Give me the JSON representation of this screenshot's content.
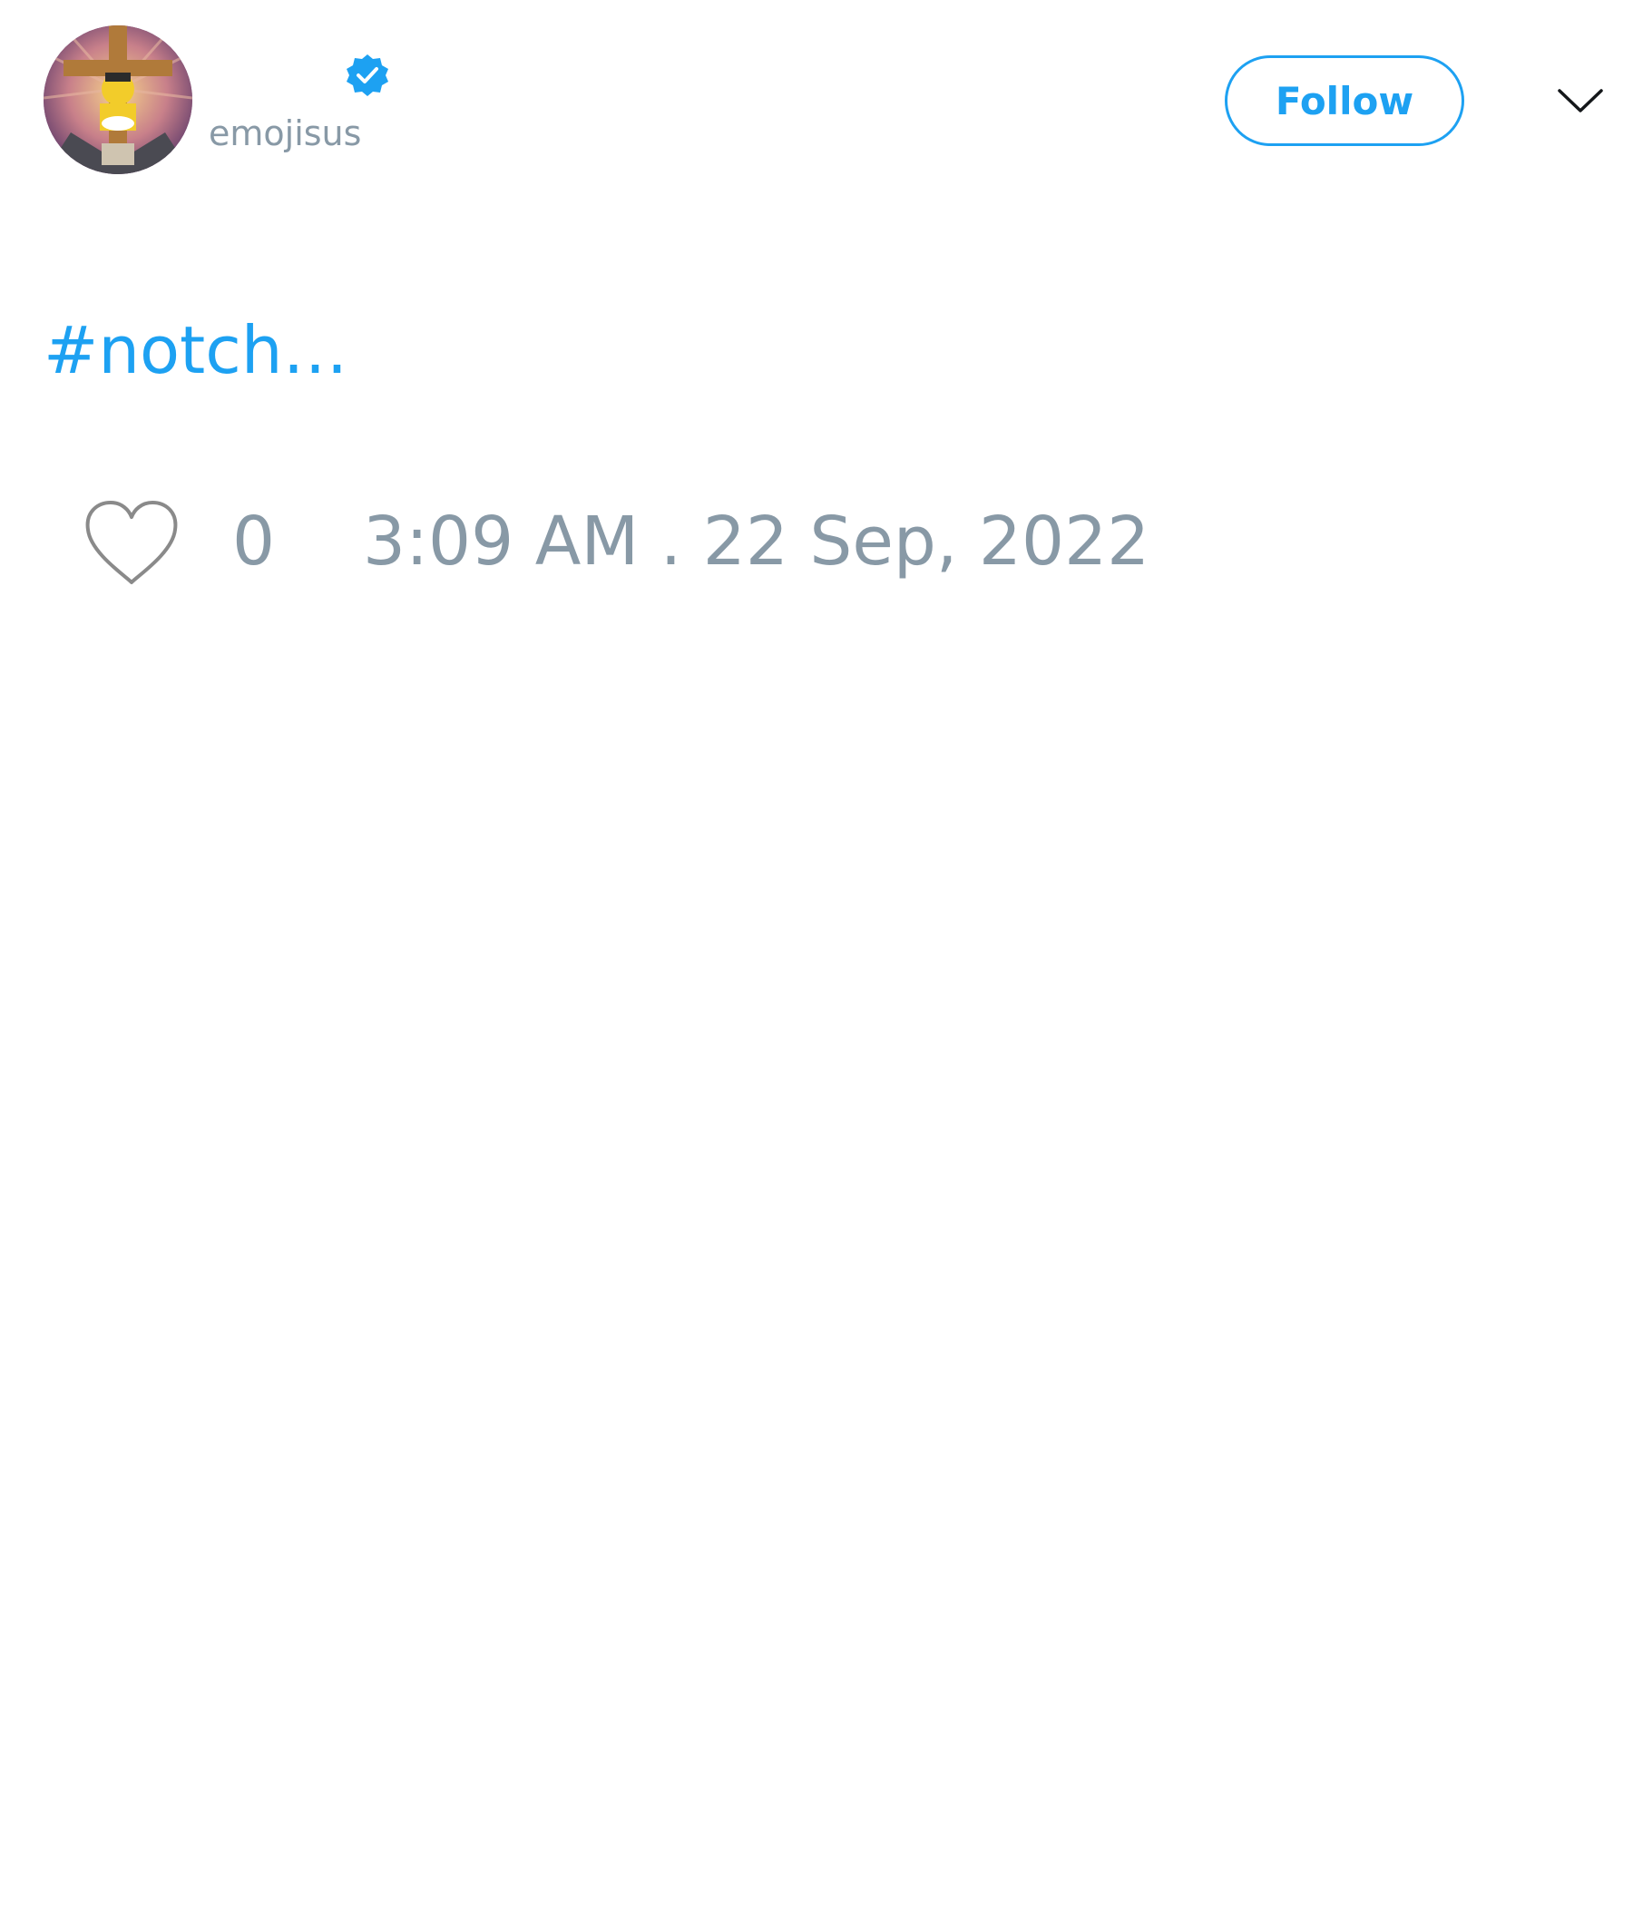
{
  "tweet": {
    "author": {
      "handle": "emojisus",
      "verified": true,
      "avatar_icon": "avatar-icon"
    },
    "follow_label": "Follow",
    "text": "#notch…",
    "like_count": "0",
    "timestamp": "3:09 AM . 22 Sep, 2022"
  },
  "icons": {
    "verified": "verified-badge-icon",
    "menu": "chevron-down-icon",
    "like": "heart-icon"
  },
  "colors": {
    "accent": "#1da1f2",
    "muted": "#8899a6",
    "background": "#ffffff"
  }
}
